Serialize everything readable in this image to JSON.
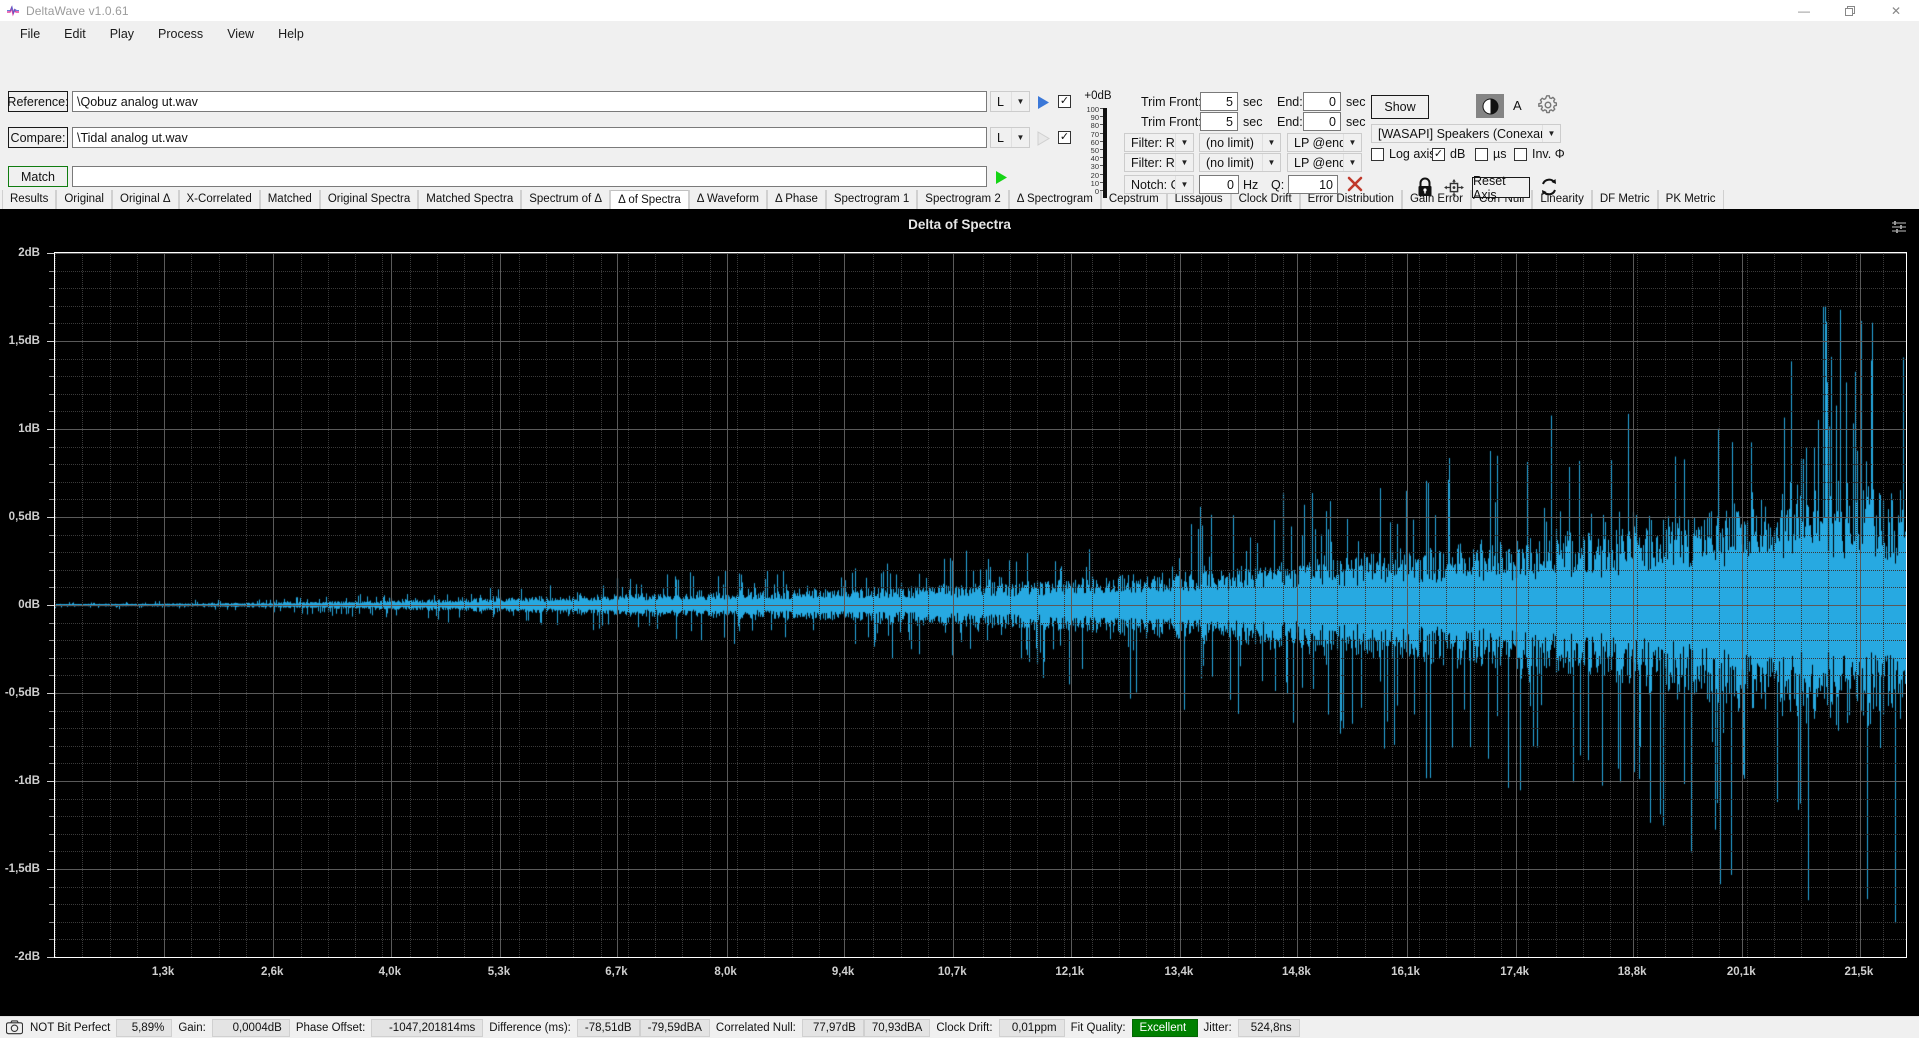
{
  "window": {
    "title": "DeltaWave v1.0.61",
    "icon": "deltawave-logo-icon",
    "minimize": "—",
    "maximize": "❐",
    "close": "✕"
  },
  "menubar": {
    "items": [
      "File",
      "Edit",
      "Play",
      "Process",
      "View",
      "Help"
    ]
  },
  "files": {
    "reference_label": "Reference:",
    "reference_value": "\\Qobuz analog ut.wav",
    "reference_channel": "L",
    "reference_checked": true,
    "compare_label": "Compare:",
    "compare_value": "\\Tidal analog ut.wav",
    "compare_channel": "L",
    "compare_checked": true,
    "match_label": "Match",
    "match_value": ""
  },
  "volume": {
    "top_label": "+0dB",
    "scale": [
      "100",
      "90",
      "80",
      "70",
      "60",
      "50",
      "40",
      "30",
      "20",
      "10",
      "0"
    ],
    "value": 0
  },
  "trim": {
    "row1": {
      "front_label": "Trim Front:",
      "front_value": "5",
      "front_unit": "sec",
      "end_label": "End:",
      "end_value": "0",
      "end_unit": "sec"
    },
    "row2": {
      "front_label": "Trim Front:",
      "front_value": "5",
      "front_unit": "sec",
      "end_label": "End:",
      "end_value": "0",
      "end_unit": "sec"
    }
  },
  "filters": {
    "row1": {
      "filter": "Filter: R+C",
      "limit": "(no limit)",
      "lp": "LP @end"
    },
    "row2": {
      "filter": "Filter: R+C",
      "limit": "(no limit)",
      "lp": "LP @end"
    },
    "notch": {
      "mode": "Notch: Off",
      "hz_value": "0",
      "hz_label": "Hz",
      "q_label": "Q:",
      "q_value": "10",
      "clear_icon": "red-x-icon"
    }
  },
  "right_panel": {
    "show_button": "Show",
    "contrast_icon": "contrast-icon",
    "font_icon": "A",
    "settings_icon": "gear-icon",
    "device": "[WASAPI] Speakers (Conexant ISST Audio)",
    "checkboxes": [
      {
        "label": "Log axis",
        "checked": false
      },
      {
        "label": "dB",
        "checked": true
      },
      {
        "label": "µs",
        "checked": false
      },
      {
        "label": "Inv. Φ",
        "checked": false
      }
    ],
    "lock_icon": "lock-icon",
    "pan_icon": "move-axis-icon",
    "reset_axis": "Reset Axis",
    "refresh_icon": "refresh-icon"
  },
  "tabs": {
    "active": "Δ of Spectra",
    "items": [
      "Results",
      "Original",
      "Original Δ",
      "X-Correlated",
      "Matched",
      "Original Spectra",
      "Matched Spectra",
      "Spectrum of Δ",
      "Δ of Spectra",
      "Δ Waveform",
      "Δ Phase",
      "Spectrogram 1",
      "Spectrogram 2",
      "Δ Spectrogram",
      "Cepstrum",
      "Lissajous",
      "Clock Drift",
      "Error Distribution",
      "Gain Error",
      "Corr Null",
      "Linearity",
      "DF Metric",
      "PK Metric"
    ]
  },
  "chart_data": {
    "type": "line",
    "title": "Delta of Spectra",
    "xlabel": "",
    "ylabel": "",
    "menu_icon": "chart-settings-icon",
    "series_color": "#27a9e1",
    "background": "#000000",
    "grid": true,
    "ylim": [
      -2,
      2
    ],
    "ytick_labels": [
      "2dB",
      "1,5dB",
      "1dB",
      "0,5dB",
      "0dB",
      "-0,5dB",
      "-1dB",
      "-1,5dB",
      "-2dB"
    ],
    "ytick_values": [
      2,
      1.5,
      1,
      0.5,
      0,
      -0.5,
      -1,
      -1.5,
      -2
    ],
    "xlim": [
      0,
      22050
    ],
    "xtick_labels": [
      "1,3k",
      "2,6k",
      "4,0k",
      "5,3k",
      "6,7k",
      "8,0k",
      "9,4k",
      "10,7k",
      "12,1k",
      "13,4k",
      "14,8k",
      "16,1k",
      "17,4k",
      "18,8k",
      "20,1k",
      "21,5k"
    ],
    "xtick_values": [
      1300,
      2600,
      4000,
      5300,
      6700,
      8000,
      9400,
      10700,
      12100,
      13400,
      14800,
      16100,
      17400,
      18800,
      20100,
      21500
    ],
    "description": "Noise-like delta spectrum: near 0dB below ~4kHz, envelope widening progressively with frequency; spread reaches roughly ±0.1dB at 6kHz, ±0.25dB at 13kHz, ±0.6dB at 19kHz and ±1.4dB peaks above 20kHz",
    "envelope": [
      {
        "f": 0,
        "amp": 0.008
      },
      {
        "f": 1300,
        "amp": 0.012
      },
      {
        "f": 2600,
        "amp": 0.02
      },
      {
        "f": 4000,
        "amp": 0.035
      },
      {
        "f": 5300,
        "amp": 0.055
      },
      {
        "f": 6700,
        "amp": 0.08
      },
      {
        "f": 8000,
        "amp": 0.1
      },
      {
        "f": 9400,
        "amp": 0.12
      },
      {
        "f": 10700,
        "amp": 0.15
      },
      {
        "f": 12100,
        "amp": 0.2
      },
      {
        "f": 13400,
        "amp": 0.26
      },
      {
        "f": 14800,
        "amp": 0.34
      },
      {
        "f": 16100,
        "amp": 0.42
      },
      {
        "f": 17400,
        "amp": 0.5
      },
      {
        "f": 18800,
        "amp": 0.6
      },
      {
        "f": 20100,
        "amp": 0.8
      },
      {
        "f": 21000,
        "amp": 0.95
      },
      {
        "f": 21500,
        "amp": 0.9
      },
      {
        "f": 22050,
        "amp": 0.85
      }
    ]
  },
  "statusbar": {
    "camera_icon": "camera-icon",
    "bit_perfect_label": "NOT Bit Perfect",
    "bit_perfect_value": "5,89%",
    "gain_label": "Gain:",
    "gain_value": "0,0004dB",
    "phase_offset_label": "Phase Offset:",
    "phase_offset_value": "-1047,201814ms",
    "difference_label": "Difference (ms):",
    "difference_value1": "-78,51dB",
    "difference_value2": "-79,59dBA",
    "correlated_null_label": "Correlated Null:",
    "correlated_null_value1": "77,97dB",
    "correlated_null_value2": "70,93dBA",
    "clock_drift_label": "Clock Drift:",
    "clock_drift_value": "0,01ppm",
    "fit_quality_label": "Fit Quality:",
    "fit_quality_value": "Excellent",
    "jitter_label": "Jitter:",
    "jitter_value": "524,8ns"
  }
}
